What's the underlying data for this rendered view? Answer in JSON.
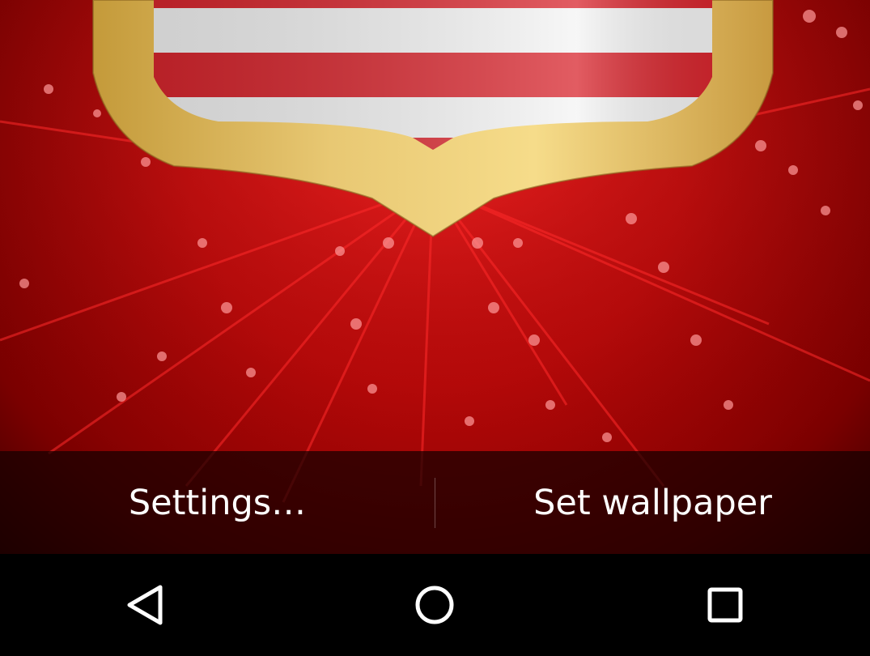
{
  "wallpaper": {
    "base_color": "#c00808",
    "stripe_red": "#d8262e",
    "stripe_white": "#f4f4f4",
    "frame_gold": "#e6c060"
  },
  "action_bar": {
    "settings_label": "Settings…",
    "set_wallpaper_label": "Set wallpaper"
  },
  "navbar": {
    "back_icon": "back-triangle-icon",
    "home_icon": "home-circle-icon",
    "recents_icon": "recents-square-icon"
  }
}
